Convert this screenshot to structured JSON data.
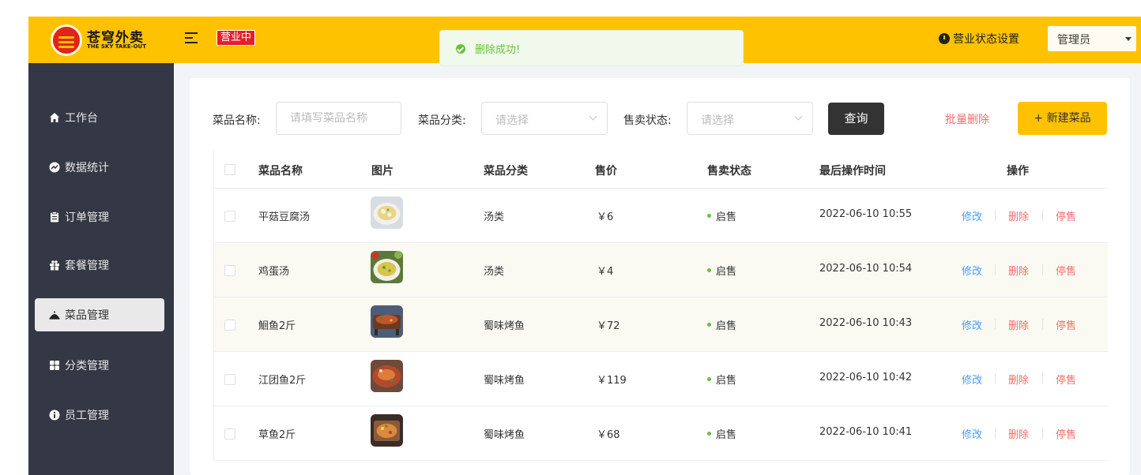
{
  "header": {
    "brand_title": "苍穹外卖",
    "brand_subtitle": "THE SKY TAKE-OUT",
    "shop_status": "营业中",
    "status_setting": "营业状态设置",
    "user": "管理员"
  },
  "toast": {
    "message": "删除成功!"
  },
  "sidebar": {
    "items": [
      {
        "label": "工作台",
        "icon": "home-icon"
      },
      {
        "label": "数据统计",
        "icon": "chart-icon"
      },
      {
        "label": "订单管理",
        "icon": "clipboard-icon"
      },
      {
        "label": "套餐管理",
        "icon": "gift-icon"
      },
      {
        "label": "菜品管理",
        "icon": "dish-cover-icon",
        "active": true
      },
      {
        "label": "分类管理",
        "icon": "grid-icon"
      },
      {
        "label": "员工管理",
        "icon": "info-person-icon"
      }
    ]
  },
  "filters": {
    "name_label": "菜品名称:",
    "name_placeholder": "请填写菜品名称",
    "category_label": "菜品分类:",
    "category_placeholder": "请选择",
    "status_label": "售卖状态:",
    "status_placeholder": "请选择",
    "query_button": "查询",
    "batch_delete": "批量删除",
    "new_dish": "+ 新建菜品"
  },
  "table": {
    "columns": [
      "菜品名称",
      "图片",
      "菜品分类",
      "售价",
      "售卖状态",
      "最后操作时间",
      "操作"
    ],
    "actions": {
      "edit": "修改",
      "delete": "删除",
      "stop": "停售"
    },
    "rows": [
      {
        "name": "平菇豆腐汤",
        "category": "汤类",
        "price": "￥6",
        "status": "启售",
        "updated": "2022-06-10 10:55"
      },
      {
        "name": "鸡蛋汤",
        "category": "汤类",
        "price": "￥4",
        "status": "启售",
        "updated": "2022-06-10 10:54"
      },
      {
        "name": "鮰鱼2斤",
        "category": "蜀味烤鱼",
        "price": "￥72",
        "status": "启售",
        "updated": "2022-06-10 10:43"
      },
      {
        "name": "江团鱼2斤",
        "category": "蜀味烤鱼",
        "price": "￥119",
        "status": "启售",
        "updated": "2022-06-10 10:42"
      },
      {
        "name": "草鱼2斤",
        "category": "蜀味烤鱼",
        "price": "￥68",
        "status": "启售",
        "updated": "2022-06-10 10:41"
      }
    ]
  },
  "colors": {
    "brand_yellow": "#ffc200",
    "sidebar_bg": "#343744",
    "edit_blue": "#419eff",
    "danger_red": "#f56c6c",
    "success_green": "#67c23a"
  }
}
